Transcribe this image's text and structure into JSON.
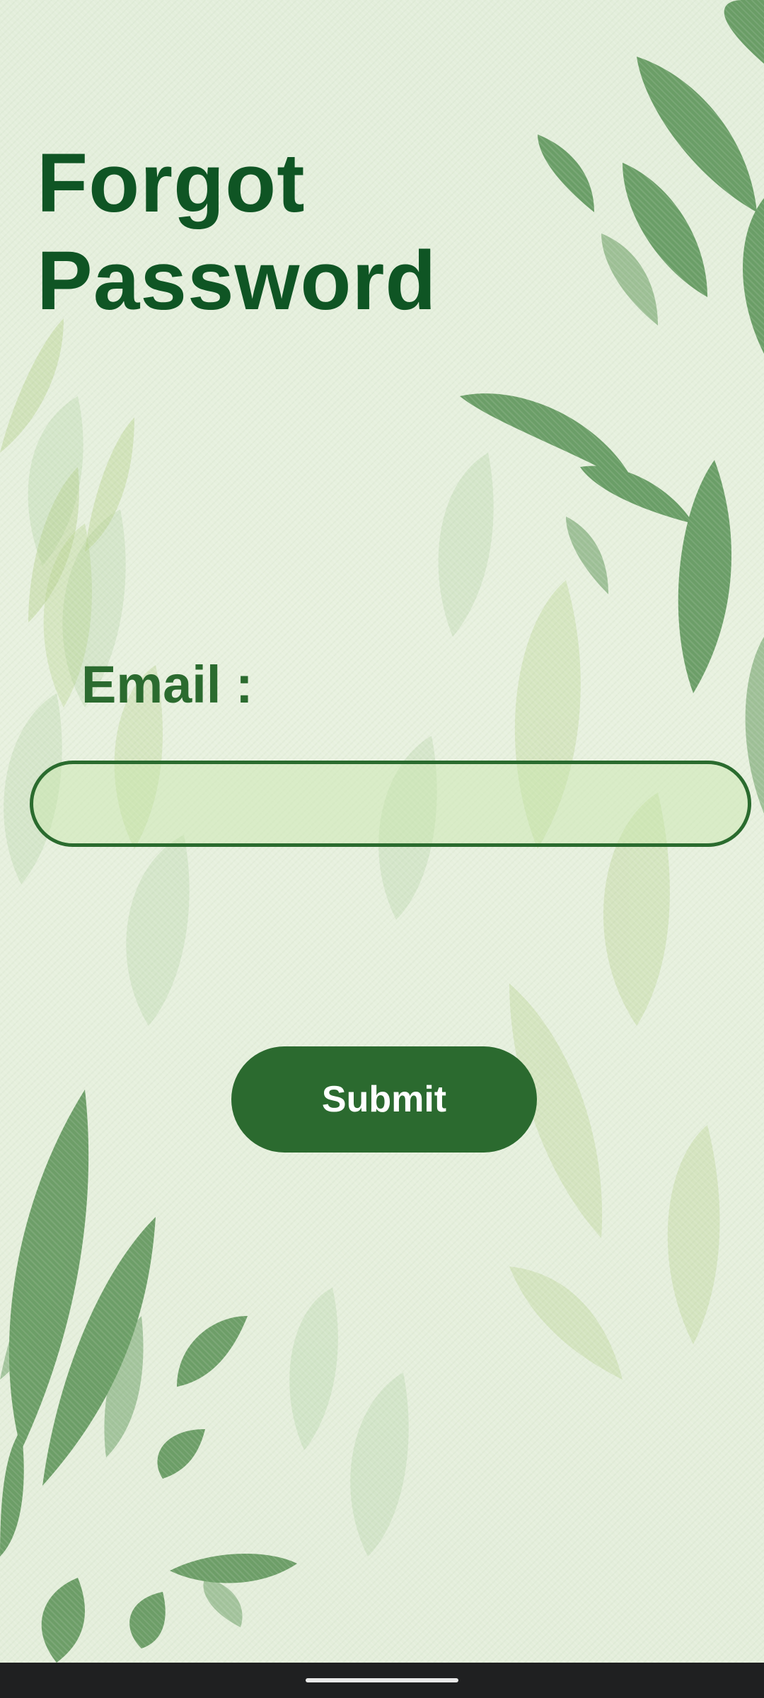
{
  "screen": {
    "title_line1": "Forgot",
    "title_line2": "Password",
    "email_label": "Email :",
    "email_value": "",
    "email_placeholder": "",
    "submit_label": "Submit"
  },
  "colors": {
    "title": "#0f5524",
    "label": "#2b6b2f",
    "button": "#2b6a2f",
    "input_border": "#2a6b2e",
    "background": "#e6f0dc"
  },
  "icons": {
    "background_art": "watercolor-leaves"
  }
}
